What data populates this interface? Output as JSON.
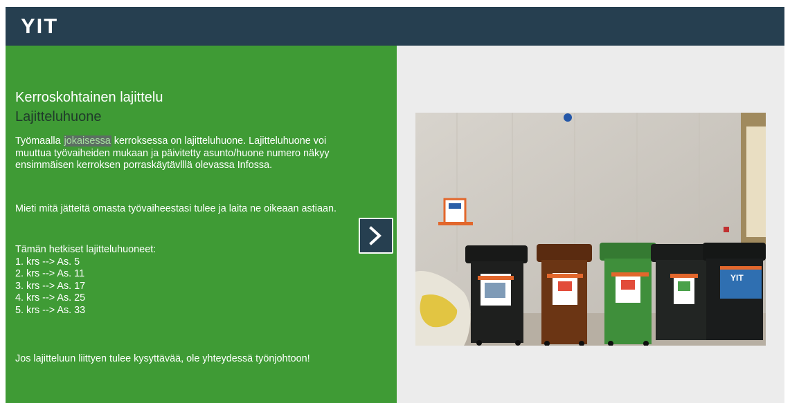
{
  "header": {
    "logo_text": "YIT",
    "background_color": "#263f50"
  },
  "content": {
    "title": "Kerroskohtainen lajittelu",
    "subtitle": "Lajitteluhuone",
    "intro": {
      "before": "Työmaalla ",
      "highlight": "jokaisessa",
      "after": " kerroksessa on lajitteluhuone. Lajitteluhuone voi muuttua työvaiheiden mukaan ja päivitetty asunto/huone numero näkyy ensimmäisen kerroksen porraskäytävlllä olevassa Infossa."
    },
    "instruction": "Mieti mitä jätteitä omasta työvaiheestasi tulee ja laita ne oikeaan astiaan.",
    "list_heading": "Tämän hetkiset lajitteluhuoneet:",
    "rooms": [
      "1. krs --> As. 5",
      "2. krs --> As. 11",
      "3. krs --> As. 17",
      "4. krs --> As. 25",
      "5. krs --> As. 33"
    ],
    "footer_note": "Jos lajitteluun liittyen tulee kysyttävää, ole yhteydessä työnjohtoon!",
    "panel_color": "#3f9b35"
  },
  "navigation": {
    "next_icon": "chevron-right-icon"
  },
  "photo": {
    "bin_colors": [
      "#1e1f1e",
      "#6b3514",
      "#3f8f3b",
      "#222523",
      "#1a1c1c"
    ],
    "sign_text": "YIT"
  }
}
